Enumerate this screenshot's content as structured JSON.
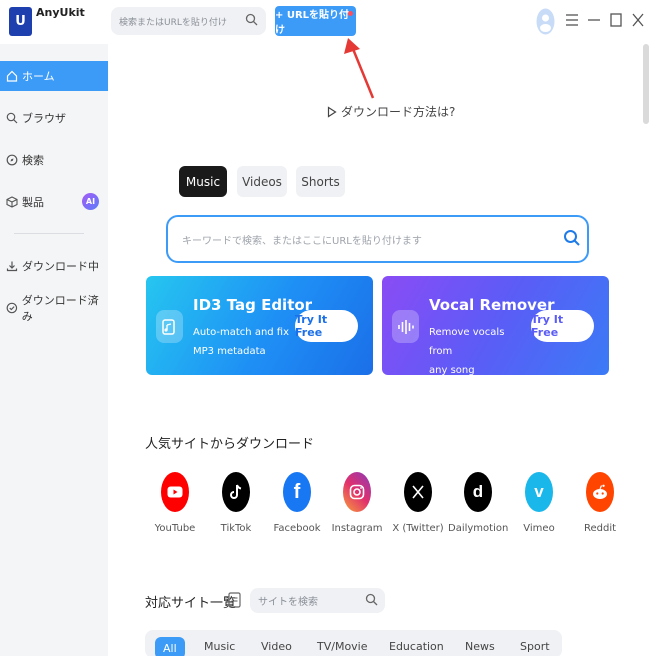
{
  "app": {
    "logo_text": "U",
    "title": "AnyUkit"
  },
  "topbar": {
    "search_placeholder": "検索またはURLを貼り付け",
    "paste_button": "+ URLを貼り付け"
  },
  "sidebar": {
    "items": [
      {
        "label": "ホーム",
        "icon": "home-icon",
        "active": true
      },
      {
        "label": "ブラウザ",
        "icon": "search-icon"
      },
      {
        "label": "検索",
        "icon": "compass-icon"
      },
      {
        "label": "製品",
        "icon": "box-icon",
        "badge": "AI"
      },
      {
        "label": "ダウンロード中",
        "icon": "download-icon"
      },
      {
        "label": "ダウンロード済み",
        "icon": "check-circle-icon"
      }
    ]
  },
  "main": {
    "howto": "ダウンロード方法は?",
    "tabs": [
      {
        "label": "Music",
        "active": true
      },
      {
        "label": "Videos"
      },
      {
        "label": "Shorts"
      }
    ],
    "search_placeholder": "キーワードで検索、またはここにURLを貼り付けます",
    "promos": [
      {
        "title": "ID3 Tag Editor",
        "desc_line1": "Auto-match and fix",
        "desc_line2": "MP3 metadata",
        "button": "Try It Free"
      },
      {
        "title": "Vocal Remover",
        "desc_line1": "Remove vocals from",
        "desc_line2": "any song",
        "button": "Try It Free"
      }
    ],
    "popular_title": "人気サイトからダウンロード",
    "sites": [
      {
        "name": "YouTube",
        "color": "#ff0000"
      },
      {
        "name": "TikTok",
        "color": "#000000"
      },
      {
        "name": "Facebook",
        "color": "#1877f2"
      },
      {
        "name": "Instagram",
        "color": "#e1306c"
      },
      {
        "name": "X (Twitter)",
        "color": "#000000"
      },
      {
        "name": "Dailymotion",
        "color": "#000000"
      },
      {
        "name": "Vimeo",
        "color": "#1ab7ea"
      },
      {
        "name": "Reddit",
        "color": "#ff4500"
      }
    ],
    "supported_title": "対応サイト一覧",
    "site_search_placeholder": "サイトを検索",
    "categories": [
      {
        "label": "All",
        "active": true
      },
      {
        "label": "Music"
      },
      {
        "label": "Video"
      },
      {
        "label": "TV/Movie"
      },
      {
        "label": "Education"
      },
      {
        "label": "News"
      },
      {
        "label": "Sport"
      }
    ]
  },
  "colors": {
    "accent": "#3d9bf8",
    "sidebar_bg": "#f4f5f7"
  }
}
